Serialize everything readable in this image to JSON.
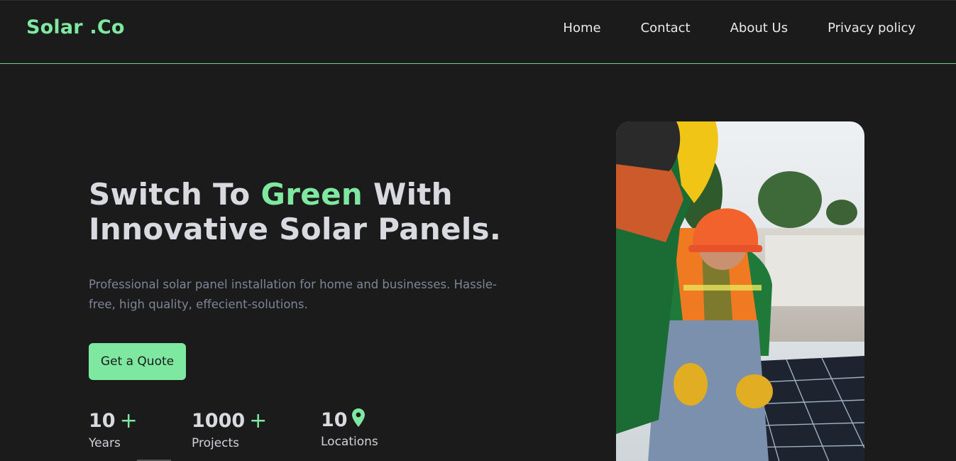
{
  "brand": {
    "name": "Solar .Co"
  },
  "nav": {
    "items": [
      {
        "label": "Home"
      },
      {
        "label": "Contact"
      },
      {
        "label": "About Us"
      },
      {
        "label": "Privacy policy"
      }
    ]
  },
  "hero": {
    "title_part1": "Switch To ",
    "title_accent": "Green",
    "title_part2": " With",
    "title_line2": "Innovative Solar Panels.",
    "subtitle": "Professional solar panel installation for home and businesses. Hassle-free, high quality, effecient-solutions.",
    "cta_label": "Get a Quote"
  },
  "stats": [
    {
      "value": "10",
      "suffix": "+",
      "label": "Years"
    },
    {
      "value": "1000",
      "suffix": "+",
      "label": "Projects"
    },
    {
      "value": "10",
      "suffix_icon": "location-pin-icon",
      "label": "Locations"
    }
  ],
  "colors": {
    "background": "#1b1b1b",
    "accent": "#7ee8a0",
    "heading": "#d8dae0",
    "muted_text": "#7d8595"
  }
}
